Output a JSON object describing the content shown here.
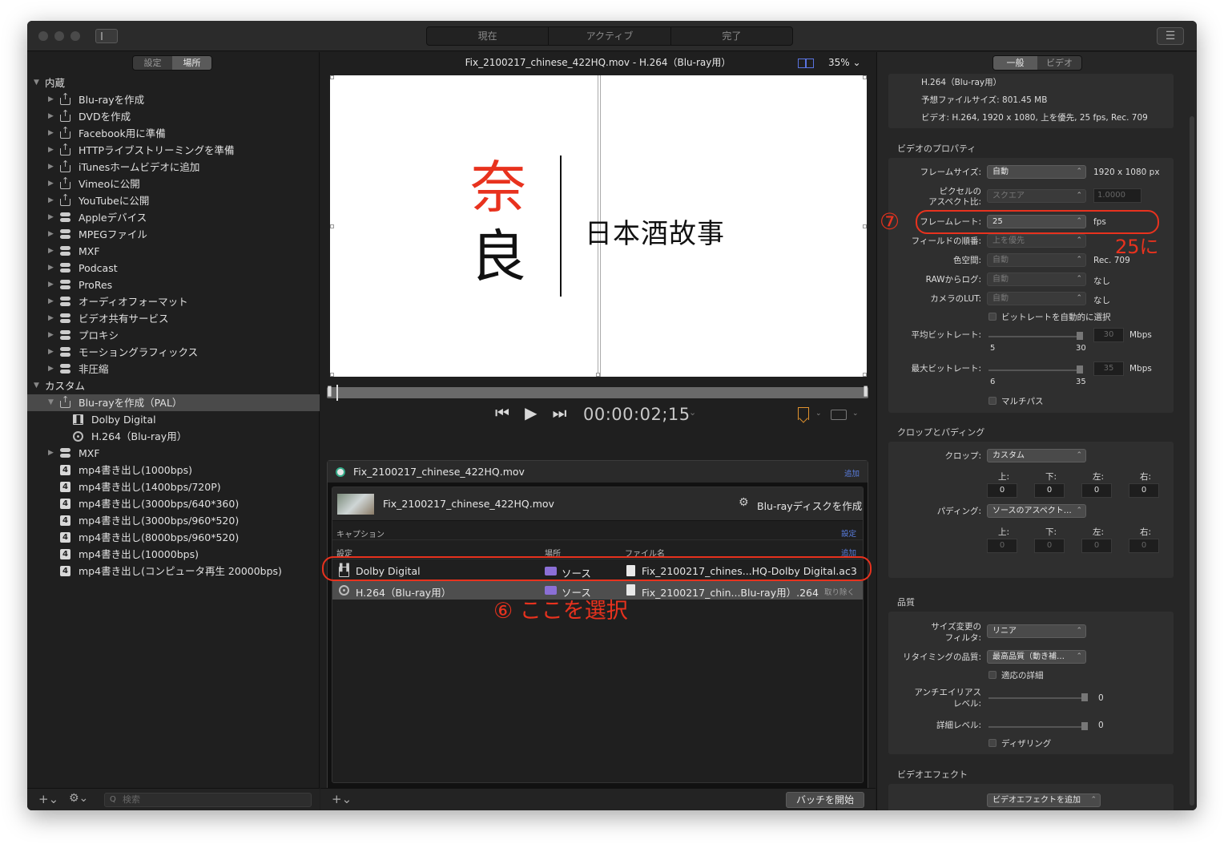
{
  "titlebar": {
    "tabs": [
      "現在",
      "アクティブ",
      "完了"
    ]
  },
  "left": {
    "tabs": [
      "設定",
      "場所"
    ],
    "groups": [
      {
        "label": "内蔵",
        "items": [
          {
            "label": "Blu-rayを作成",
            "icon": "share-icon"
          },
          {
            "label": "DVDを作成",
            "icon": "share-icon"
          },
          {
            "label": "Facebook用に準備",
            "icon": "share-icon"
          },
          {
            "label": "HTTPライブストリーミングを準備",
            "icon": "share-icon"
          },
          {
            "label": "iTunesホームビデオに追加",
            "icon": "share-icon"
          },
          {
            "label": "Vimeoに公開",
            "icon": "share-icon"
          },
          {
            "label": "YouTubeに公開",
            "icon": "share-icon"
          },
          {
            "label": "Appleデバイス",
            "icon": "preset-group-icon"
          },
          {
            "label": "MPEGファイル",
            "icon": "preset-group-icon"
          },
          {
            "label": "MXF",
            "icon": "preset-group-icon"
          },
          {
            "label": "Podcast",
            "icon": "preset-group-icon"
          },
          {
            "label": "ProRes",
            "icon": "preset-group-icon"
          },
          {
            "label": "オーディオフォーマット",
            "icon": "preset-group-icon"
          },
          {
            "label": "ビデオ共有サービス",
            "icon": "preset-group-icon"
          },
          {
            "label": "プロキシ",
            "icon": "preset-group-icon"
          },
          {
            "label": "モーショングラフィックス",
            "icon": "preset-group-icon"
          },
          {
            "label": "非圧縮",
            "icon": "preset-group-icon"
          }
        ]
      },
      {
        "label": "カスタム",
        "selected": "Blu-rayを作成（PAL）",
        "children": [
          "Dolby Digital",
          "H.264（Blu-ray用）"
        ],
        "items": [
          {
            "label": "MXF",
            "icon": "preset-group-icon"
          },
          {
            "label": "mp4書き出し(1000bps)",
            "icon": "mp4-icon"
          },
          {
            "label": "mp4書き出し(1400bps/720P)",
            "icon": "mp4-icon"
          },
          {
            "label": "mp4書き出し(3000bps/640*360)",
            "icon": "mp4-icon"
          },
          {
            "label": "mp4書き出し(3000bps/960*520)",
            "icon": "mp4-icon"
          },
          {
            "label": "mp4書き出し(8000bps/960*520)",
            "icon": "mp4-icon"
          },
          {
            "label": "mp4書き出し(10000bps)",
            "icon": "mp4-icon"
          },
          {
            "label": "mp4書き出し(コンピュータ再生 20000bps)",
            "icon": "mp4-icon"
          }
        ]
      }
    ],
    "search_placeholder": "検索"
  },
  "center": {
    "title": "Fix_2100217_chinese_422HQ.mov - H.264（Blu-ray用）",
    "zoom": "35%",
    "preview_text": {
      "red": "奈",
      "black": "良",
      "sub": "日本酒故事"
    },
    "timecode": "00:00:02;15",
    "batch": {
      "source_file": "Fix_2100217_chinese_422HQ.mov",
      "add_label": "追加",
      "job_name": "Fix_2100217_chinese_422HQ.mov",
      "job_action": "Blu-rayディスクを作成",
      "captions_label": "キャプション",
      "captions_action": "設定",
      "col_setting": "設定",
      "col_location": "場所",
      "col_filename": "ファイル名",
      "col_add": "追加",
      "outputs": [
        {
          "setting": "Dolby Digital",
          "location": "ソース",
          "file": "Fix_2100217_chines...HQ-Dolby Digital.ac3",
          "remove": ""
        },
        {
          "setting": "H.264（Blu-ray用）",
          "location": "ソース",
          "file": "Fix_2100217_chin...Blu-ray用）.264",
          "remove": "取り除く"
        }
      ]
    },
    "start_button": "バッチを開始"
  },
  "inspector": {
    "tabs": [
      "一般",
      "ビデオ"
    ],
    "summary": {
      "codec": "H.264（Blu-ray用）",
      "size": "予想ファイルサイズ: 801.45 MB",
      "video": "ビデオ: H.264, 1920 x 1080, 上を優先, 25 fps, Rec. 709"
    },
    "video_props": {
      "title": "ビデオのプロパティ",
      "frame_size_label": "フレームサイズ:",
      "frame_size": "自動",
      "frame_size_value": "1920 x 1080 px",
      "pixel_aspect_label_1": "ピクセルの",
      "pixel_aspect_label_2": "アスペクト比:",
      "pixel_aspect": "スクエア",
      "pixel_aspect_value": "1.0000",
      "frame_rate_label": "フレームレート:",
      "frame_rate": "25",
      "frame_rate_unit": "fps",
      "field_order_label": "フィールドの順番:",
      "field_order": "上を優先",
      "color_space_label": "色空間:",
      "color_space": "自動",
      "color_space_value": "Rec. 709",
      "raw_log_label": "RAWからログ:",
      "raw_log": "自動",
      "raw_log_value": "なし",
      "camera_lut_label": "カメラのLUT:",
      "camera_lut": "自動",
      "camera_lut_value": "なし",
      "auto_bitrate": "ビットレートを自動的に選択",
      "avg_bitrate_label": "平均ビットレート:",
      "avg_bitrate": "30",
      "avg_min": "5",
      "avg_max": "30",
      "max_bitrate_label": "最大ビットレート:",
      "max_bitrate": "35",
      "max_min": "6",
      "max_max": "35",
      "unit": "Mbps",
      "multipass": "マルチパス"
    },
    "crop": {
      "title": "クロップとパディング",
      "crop_label": "クロップ:",
      "crop_value": "カスタム",
      "padding_label": "パディング:",
      "padding_value": "ソースのアスペクト…",
      "sides": [
        "上:",
        "下:",
        "左:",
        "右:"
      ],
      "crop_values": [
        "0",
        "0",
        "0",
        "0"
      ],
      "pad_values": [
        "0",
        "0",
        "0",
        "0"
      ]
    },
    "quality": {
      "title": "品質",
      "resize_label_1": "サイズ変更の",
      "resize_label_2": "フィルタ:",
      "resize_value": "リニア",
      "retime_label": "リタイミングの品質:",
      "retime_value": "最高品質（動き補…",
      "adaptive": "適応の詳細",
      "aa_label_1": "アンチエイリアス",
      "aa_label_2": "レベル:",
      "aa_value": "0",
      "detail_label": "詳細レベル:",
      "detail_value": "0",
      "dither": "ディザリング"
    },
    "effects": {
      "title": "ビデオエフェクト",
      "add": "ビデオエフェクトを追加"
    }
  },
  "annotations": {
    "step7": "⑦",
    "step7_note": "25に",
    "step6": "⑥ ここを選択"
  },
  "colors": {
    "annotation": "#e8321e",
    "accent": "#5a7ee0",
    "bookmark": "#e0922e"
  }
}
